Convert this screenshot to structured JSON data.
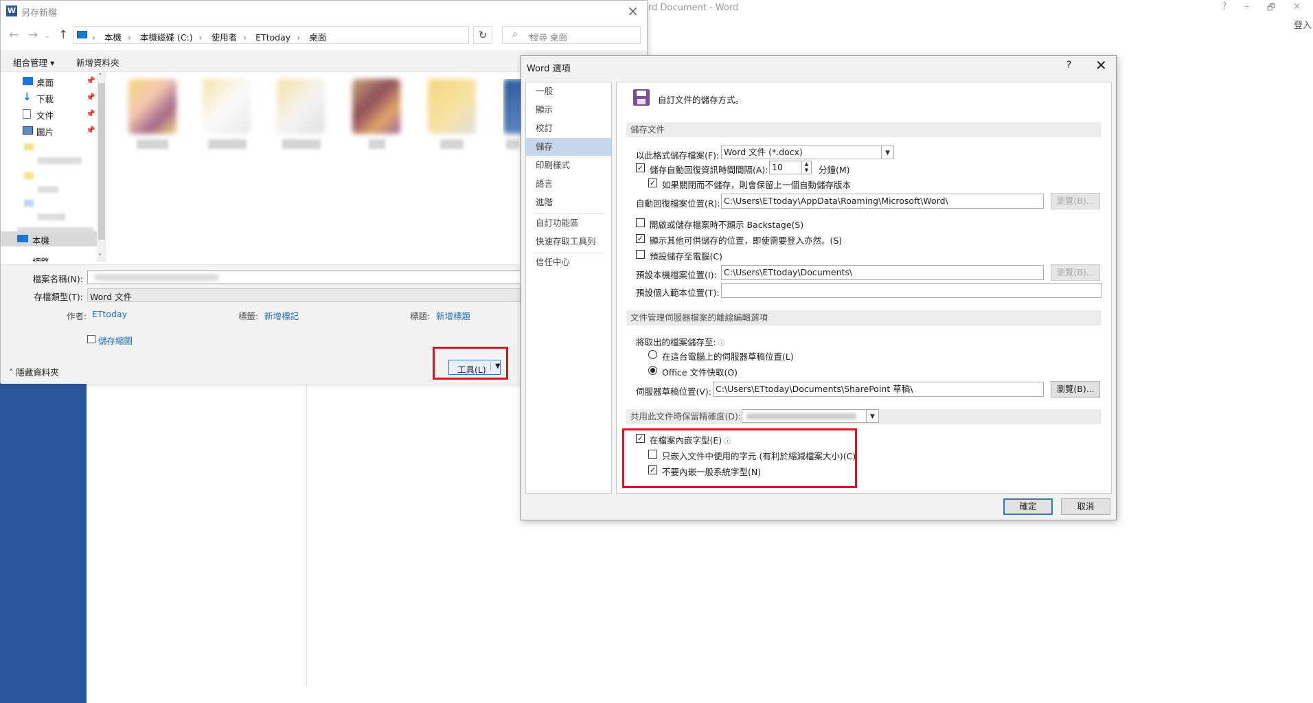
{
  "word": {
    "title": "rd Document - Word",
    "controls": [
      "?",
      "–",
      "🗗",
      "×"
    ],
    "sign_in": "登入"
  },
  "save_as": {
    "title": "另存新檔",
    "app_icon": "W",
    "address": {
      "segments": [
        "本機",
        "本機磁碟 (C:)",
        "使用者",
        "ETtoday",
        "桌面"
      ],
      "separator": "›"
    },
    "search_placeholder": "搜尋 桌面",
    "toolbar": {
      "organize": "組合管理 ▾",
      "new_folder": "新增資料夾"
    },
    "tree": [
      {
        "label": "桌面",
        "icon": "desktop-icon",
        "pinned": true
      },
      {
        "label": "下載",
        "icon": "download-icon",
        "pinned": true
      },
      {
        "label": "文件",
        "icon": "document-icon",
        "pinned": true
      },
      {
        "label": "圖片",
        "icon": "pictures-icon",
        "pinned": true
      }
    ],
    "tree_this_pc": "本機",
    "tree_network": "網路",
    "filename_label": "檔案名稱(N):",
    "filetype_label": "存檔類型(T):",
    "filetype_value": "Word 文件",
    "meta": {
      "author_label": "作者:",
      "author_value": "ETtoday",
      "tags_label": "標籤:",
      "tags_value": "新增標記",
      "title_label": "標題:",
      "title_value": "新增標題"
    },
    "save_thumbnail": "儲存縮圖",
    "hide_folders": "隱藏資料夾",
    "tools_button": "工具(L)"
  },
  "word_options": {
    "title": "Word 選項",
    "help": "?",
    "close": "✕",
    "nav": [
      "一般",
      "顯示",
      "校訂",
      "儲存",
      "印刷樣式",
      "語言",
      "進階",
      "自訂功能區",
      "快速存取工具列",
      "信任中心"
    ],
    "selected_nav": "儲存",
    "header": "自訂文件的儲存方式。",
    "sections": {
      "save_docs": "儲存文件",
      "offline": "文件管理伺服器檔案的離線編輯選項",
      "fidelity": "共用此文件時保留精確度(D):"
    },
    "save_format_label": "以此格式儲存檔案(F):",
    "save_format_value": "Word 文件 (*.docx)",
    "autorecover_label": "儲存自動回復資訊時間間隔(A):",
    "autorecover_minutes": "10",
    "minutes_label": "分鐘(M)",
    "keep_last_autosave": "如果關閉而不儲存，則會保留上一個自動儲存版本",
    "autorecover_location_label": "自動回復檔案位置(R):",
    "autorecover_location": "C:\\Users\\ETtoday\\AppData\\Roaming\\Microsoft\\Word\\",
    "browse": "瀏覽(B)...",
    "no_backstage": "開啟或儲存檔案時不顯示 Backstage(S)",
    "show_other_locations": "顯示其他可供儲存的位置，即使需要登入亦然。(S)",
    "save_to_computer": "預設儲存至電腦(C)",
    "default_local_label": "預設本機檔案位置(I):",
    "default_local": "C:\\Users\\ETtoday\\Documents\\",
    "default_template_label": "預設個人範本位置(T):",
    "default_template": "",
    "checkout_label": "將取出的檔案儲存至:",
    "server_drafts_on_computer": "在這台電腦上的伺服器草稿位置(L)",
    "office_cache": "Office 文件快取(O)",
    "server_drafts_label": "伺服器草稿位置(V):",
    "server_drafts": "C:\\Users\\ETtoday\\Documents\\SharePoint 草稿\\",
    "server_browse": "瀏覽(B)...",
    "embed_fonts": "在檔案內嵌字型(E)",
    "embed_used_only": "只嵌入文件中使用的字元 (有利於縮減檔案大小)(C)",
    "no_common_fonts": "不要內嵌一般系統字型(N)",
    "ok": "確定",
    "cancel": "取消",
    "state": {
      "autorecover": true,
      "keep_last_autosave": true,
      "no_backstage": false,
      "show_other_locations": true,
      "save_to_computer": false,
      "embed_fonts": true,
      "embed_used_only": false,
      "no_common_fonts": true,
      "checkout_option": "office_cache"
    }
  },
  "colors": {
    "word_blue": "#2b579a",
    "highlight_red": "#d4141e",
    "link_blue": "#1f6fb6",
    "nav_selected": "#c6d7ee"
  }
}
